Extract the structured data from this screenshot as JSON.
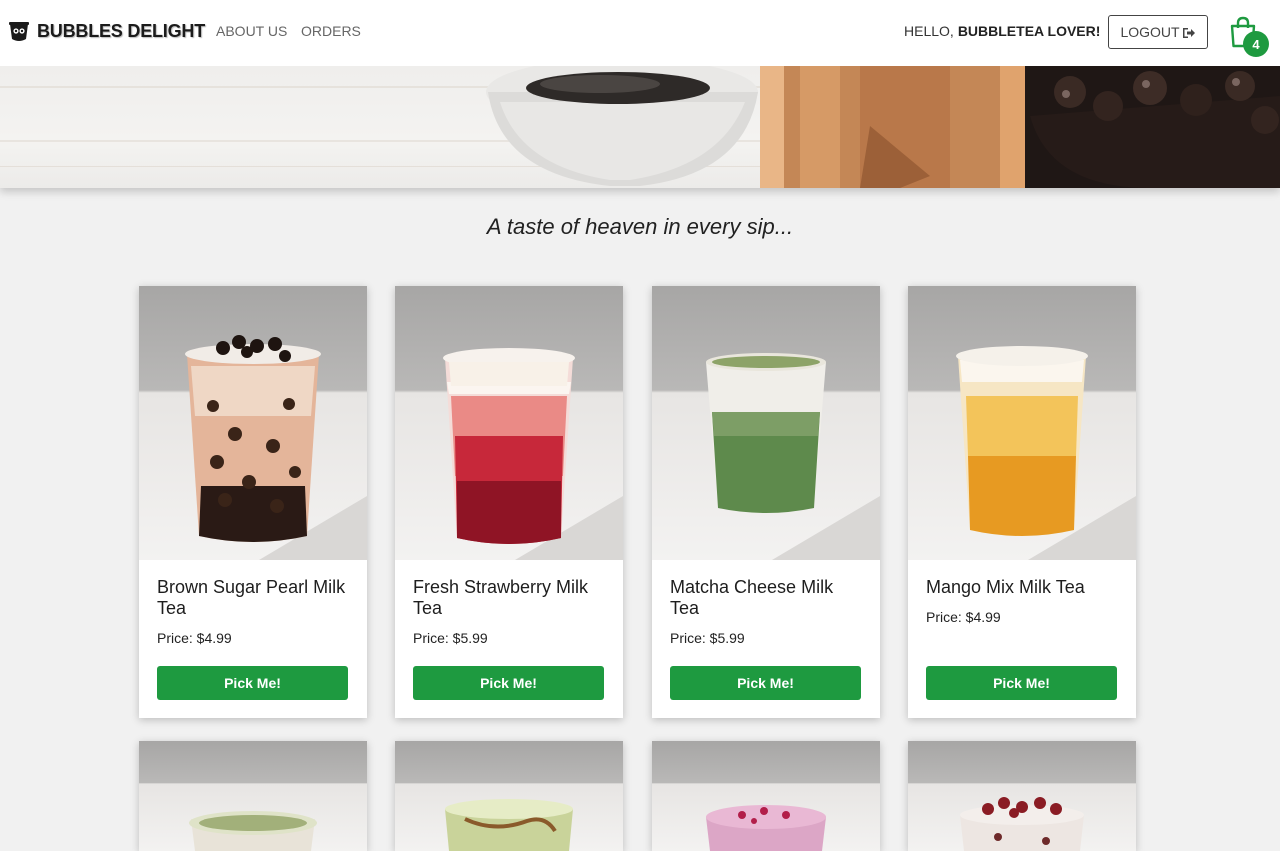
{
  "navbar": {
    "brand": "BUBBLES DELIGHT",
    "links": [
      {
        "label": "ABOUT US"
      },
      {
        "label": "ORDERS"
      }
    ],
    "greeting": "HELLO,",
    "username": "BUBBLETEA LOVER!",
    "logout_label": "LOGOUT",
    "cart_count": "4",
    "icons": {
      "brand": "bubble-tea-cup-icon",
      "logout": "sign-out-icon",
      "cart": "shopping-bag-icon"
    }
  },
  "hero": {
    "image": "boba-pearls-banner"
  },
  "tagline": "A taste of heaven in every sip...",
  "colors": {
    "accent": "#1e9a40",
    "background": "#f1f1f1"
  },
  "products": [
    {
      "name": "Brown Sugar Pearl Milk Tea",
      "price": "Price: $4.99",
      "button": "Pick Me!",
      "image": "brown-sugar-milk-tea-photo"
    },
    {
      "name": "Fresh Strawberry Milk Tea",
      "price": "Price: $5.99",
      "button": "Pick Me!",
      "image": "strawberry-milk-tea-photo"
    },
    {
      "name": "Matcha Cheese Milk Tea",
      "price": "Price: $5.99",
      "button": "Pick Me!",
      "image": "matcha-cheese-milk-tea-photo"
    },
    {
      "name": "Mango Mix Milk Tea",
      "price": "Price: $4.99",
      "button": "Pick Me!",
      "image": "mango-milk-tea-photo"
    }
  ],
  "products_row2": [
    {
      "image": "matcha-milk-tea-photo"
    },
    {
      "image": "green-tea-latte-photo"
    },
    {
      "image": "taro-milk-tea-photo"
    },
    {
      "image": "red-bean-milk-tea-photo"
    }
  ]
}
